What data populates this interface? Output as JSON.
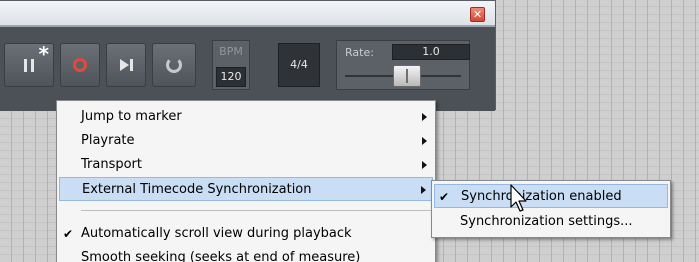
{
  "transport": {
    "asterisk": "*",
    "bpm_label": "BPM",
    "bpm_value": "120",
    "time_signature": "4/4",
    "rate_label": "Rate:",
    "rate_value": "1.0",
    "close_label": "✕"
  },
  "context_menu": {
    "items": [
      {
        "label": "Jump to marker",
        "submenu": true
      },
      {
        "label": "Playrate",
        "submenu": true
      },
      {
        "label": "Transport",
        "submenu": true
      },
      {
        "label": "External Timecode Synchronization",
        "submenu": true,
        "highlighted": true
      },
      {
        "label": "Automatically scroll view during playback",
        "checked": true
      },
      {
        "label": "Smooth seeking (seeks at end of measure)"
      }
    ]
  },
  "submenu": {
    "items": [
      {
        "label": "Synchronization enabled",
        "checked": true,
        "highlighted": true
      },
      {
        "label": "Synchronization settings..."
      }
    ]
  },
  "glyphs": {
    "checkmark": "✔"
  },
  "colors": {
    "highlight": "#c9ddf4",
    "record": "#e04a3c",
    "transport_bg": "#4c5157"
  }
}
